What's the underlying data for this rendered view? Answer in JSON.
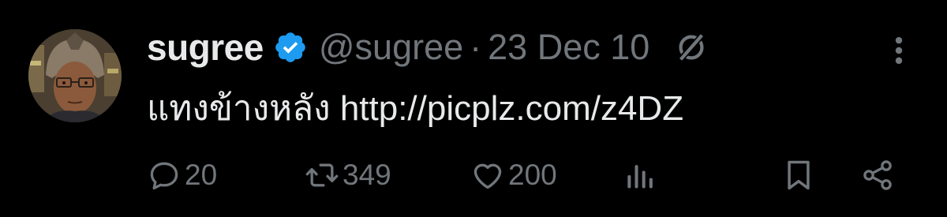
{
  "tweet": {
    "author": {
      "display_name": "sugree",
      "handle": "@sugree",
      "verified": true
    },
    "separator": "·",
    "date": "23 Dec 10",
    "text": "แทงข้างหลัง",
    "link": "http://picplz.com/z4DZ"
  },
  "actions": {
    "replies": "20",
    "retweets": "349",
    "likes": "200"
  },
  "icons": {
    "verified": "verified-badge-icon",
    "grok": "grok-icon",
    "more": "more-vertical-icon",
    "reply": "reply-bubble-icon",
    "retweet": "retweet-icon",
    "like": "heart-icon",
    "views": "analytics-bars-icon",
    "bookmark": "bookmark-icon",
    "share": "share-icon"
  },
  "colors": {
    "background": "#000000",
    "primary_text": "#e7e9ea",
    "secondary_text": "#71767b",
    "verified_blue": "#1d9bf0"
  }
}
